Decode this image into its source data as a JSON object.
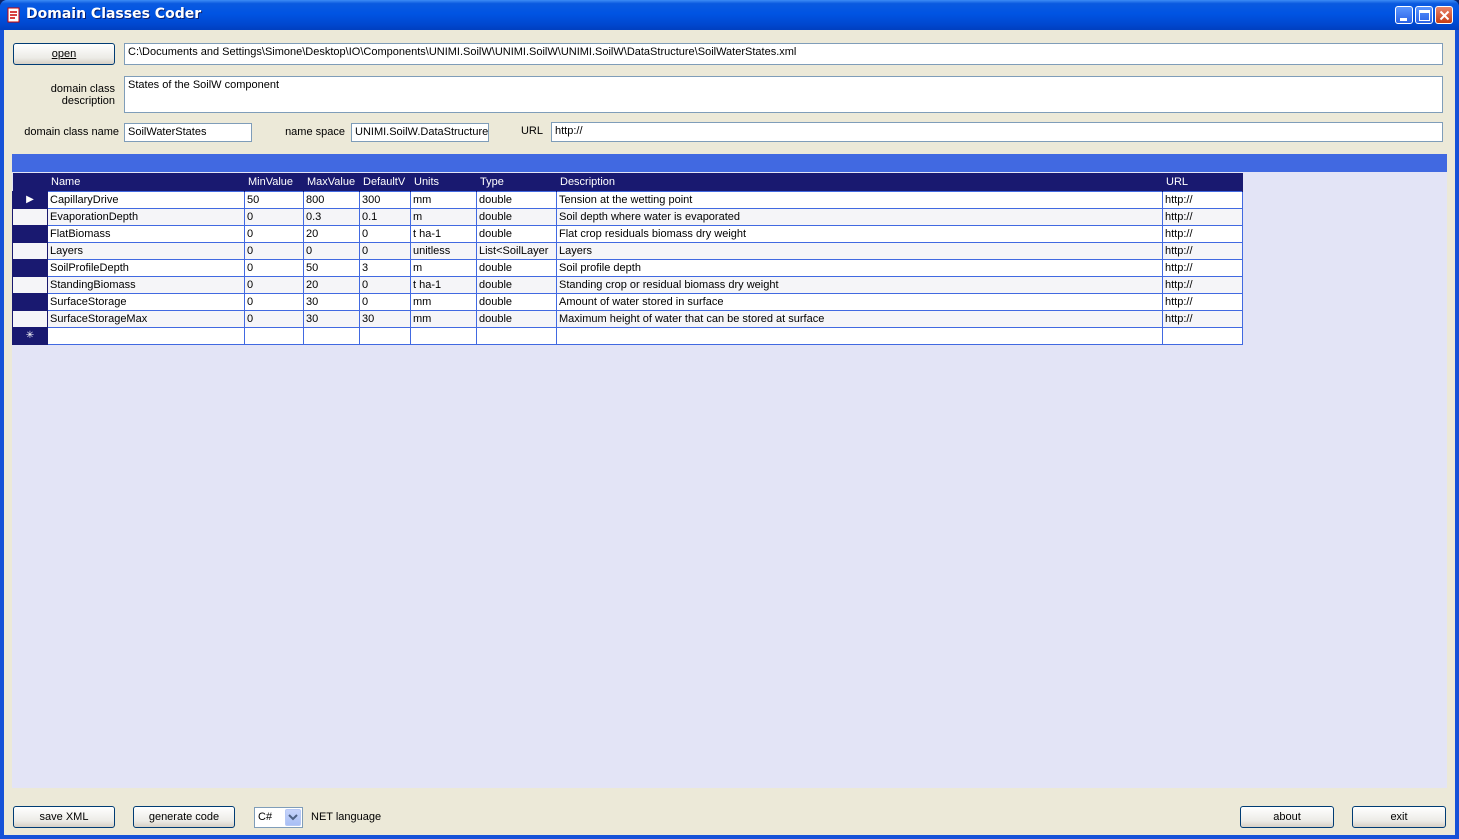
{
  "window": {
    "title": "Domain Classes Coder"
  },
  "top": {
    "open_label": "open",
    "file_path": "C:\\Documents and Settings\\Simone\\Desktop\\IO\\Components\\UNIMI.SoilW\\UNIMI.SoilW\\UNIMI.SoilW\\DataStructure\\SoilWaterStates.xml",
    "description_label_1": "domain class",
    "description_label_2": "description",
    "description_value": "States of the SoilW component",
    "class_name_label": "domain class name",
    "class_name_value": "SoilWaterStates",
    "namespace_label": "name space",
    "namespace_value": "UNIMI.SoilW.DataStructure",
    "url_label": "URL",
    "url_value": "http://"
  },
  "grid": {
    "columns": [
      "Name",
      "MinValue",
      "MaxValue",
      "DefaultV",
      "Units",
      "Type",
      "Description",
      "URL"
    ],
    "rows": [
      [
        "CapillaryDrive",
        "50",
        "800",
        "300",
        "mm",
        "double",
        "Tension at the wetting point",
        "http://"
      ],
      [
        "EvaporationDepth",
        "0",
        "0.3",
        "0.1",
        "m",
        "double",
        "Soil depth where water is evaporated",
        "http://"
      ],
      [
        "FlatBiomass",
        "0",
        "20",
        "0",
        "t ha-1",
        "double",
        "Flat crop residuals biomass dry weight",
        "http://"
      ],
      [
        "Layers",
        "0",
        "0",
        "0",
        "unitless",
        "List<SoilLayer",
        "Layers",
        "http://"
      ],
      [
        "SoilProfileDepth",
        "0",
        "50",
        "3",
        "m",
        "double",
        "Soil profile depth",
        "http://"
      ],
      [
        "StandingBiomass",
        "0",
        "20",
        "0",
        "t ha-1",
        "double",
        "Standing crop or residual biomass dry weight",
        "http://"
      ],
      [
        "SurfaceStorage",
        "0",
        "30",
        "0",
        "mm",
        "double",
        "Amount of water stored in surface",
        "http://"
      ],
      [
        "SurfaceStorageMax",
        "0",
        "30",
        "30",
        "mm",
        "double",
        "Maximum height of water that can be stored at surface",
        "http://"
      ]
    ],
    "current_row_marker": "▶",
    "new_row_marker": "✳"
  },
  "bottom": {
    "save_xml_label": "save XML",
    "generate_code_label": "generate code",
    "language_value": "C#",
    "language_label": "NET language",
    "about_label": "about",
    "exit_label": "exit"
  },
  "colors": {
    "titlebar": "#0054e3",
    "grid_header": "#191970",
    "grid_caption": "#4169e1",
    "grid_background": "#e3e4f6"
  }
}
